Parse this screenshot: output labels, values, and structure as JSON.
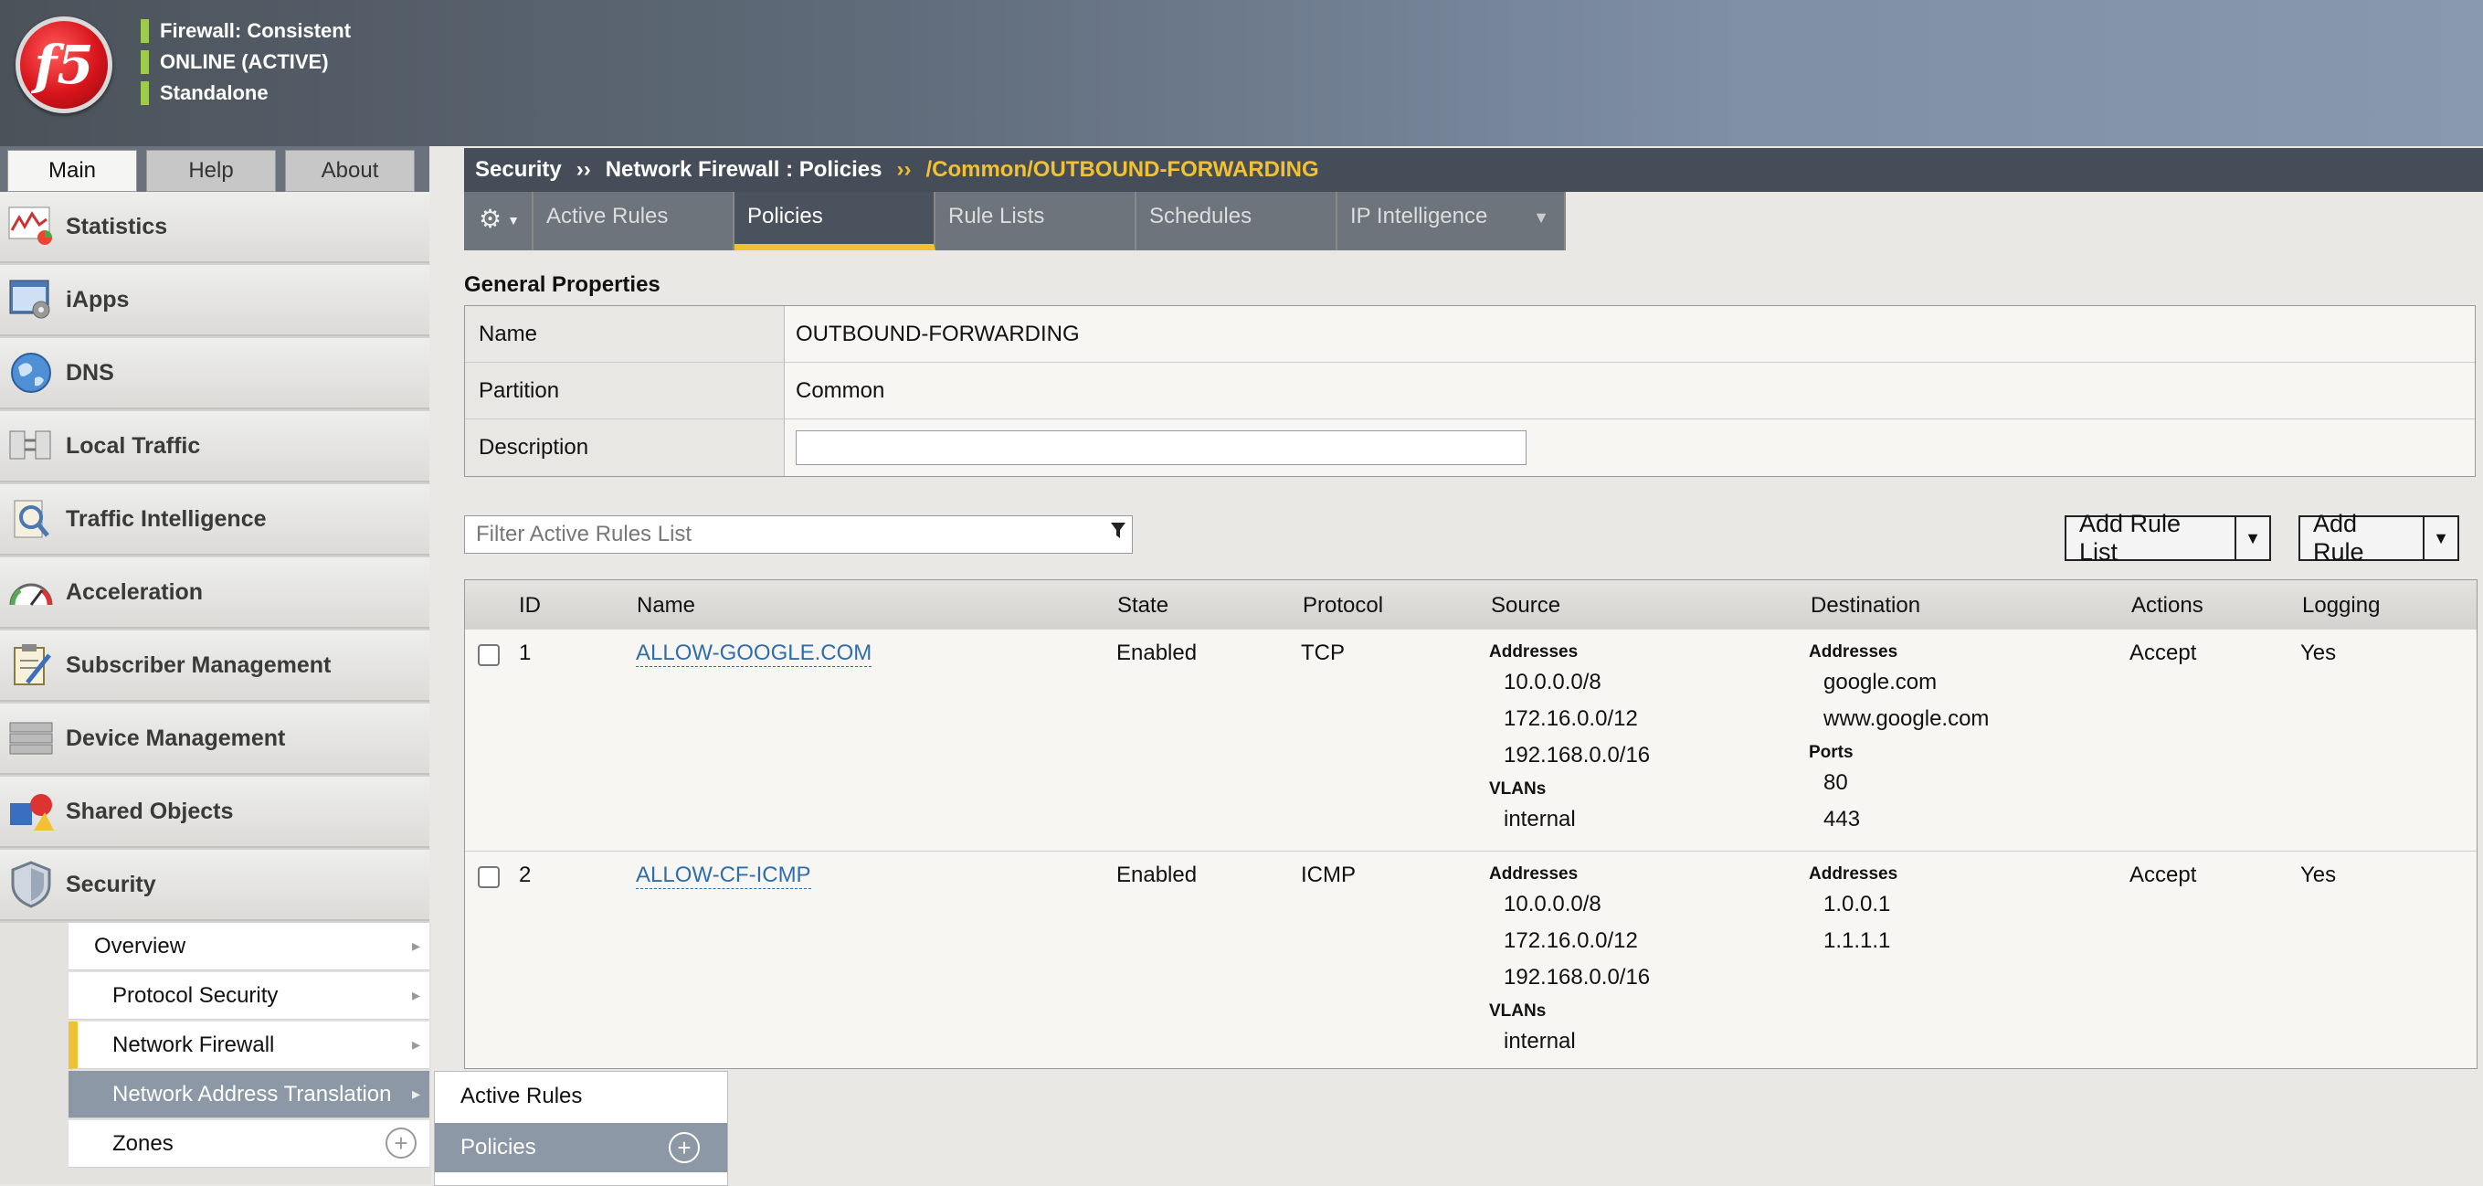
{
  "header": {
    "logo_text": "f5",
    "status": [
      "Firewall: Consistent",
      "ONLINE (ACTIVE)",
      "Standalone"
    ],
    "status_color": "#9ccb4d"
  },
  "main_tabs": [
    "Main",
    "Help",
    "About"
  ],
  "sidebar": {
    "items": [
      {
        "label": "Statistics",
        "icon": "statistics-icon"
      },
      {
        "label": "iApps",
        "icon": "iapps-icon"
      },
      {
        "label": "DNS",
        "icon": "globe-icon"
      },
      {
        "label": "Local Traffic",
        "icon": "local-traffic-icon"
      },
      {
        "label": "Traffic Intelligence",
        "icon": "traffic-intelligence-icon"
      },
      {
        "label": "Acceleration",
        "icon": "speedometer-icon"
      },
      {
        "label": "Subscriber Management",
        "icon": "clipboard-icon"
      },
      {
        "label": "Device Management",
        "icon": "server-icon"
      },
      {
        "label": "Shared Objects",
        "icon": "shapes-icon"
      },
      {
        "label": "Security",
        "icon": "shield-icon"
      }
    ],
    "submenu": [
      "Overview",
      "Protocol Security",
      "Network Firewall",
      "Network Address Translation",
      "Zones"
    ],
    "flyout": [
      "Active Rules",
      "Policies"
    ]
  },
  "breadcrumb": {
    "items": [
      "Security",
      "Network Firewall : Policies"
    ],
    "current": "/Common/OUTBOUND-FORWARDING",
    "separator": "››"
  },
  "subtabs": [
    "Active Rules",
    "Policies",
    "Rule Lists",
    "Schedules",
    "IP Intelligence"
  ],
  "general": {
    "title": "General Properties",
    "rows": [
      {
        "label": "Name",
        "value": "OUTBOUND-FORWARDING"
      },
      {
        "label": "Partition",
        "value": "Common"
      },
      {
        "label": "Description",
        "value": ""
      }
    ]
  },
  "filter_placeholder": "Filter Active Rules List",
  "buttons": {
    "add_rule_list": "Add Rule List",
    "add_rule": "Add Rule"
  },
  "rules": {
    "columns": [
      "ID",
      "Name",
      "State",
      "Protocol",
      "Source",
      "Destination",
      "Actions",
      "Logging"
    ],
    "sub_labels": {
      "addresses": "Addresses",
      "vlans": "VLANs",
      "ports": "Ports"
    },
    "rows": [
      {
        "id": "1",
        "name": "ALLOW-GOOGLE.COM",
        "state": "Enabled",
        "protocol": "TCP",
        "source": {
          "addresses": [
            "10.0.0.0/8",
            "172.16.0.0/12",
            "192.168.0.0/16"
          ],
          "vlans": [
            "internal"
          ]
        },
        "destination": {
          "addresses": [
            "google.com",
            "www.google.com"
          ],
          "ports": [
            "80",
            "443"
          ]
        },
        "action": "Accept",
        "logging": "Yes"
      },
      {
        "id": "2",
        "name": "ALLOW-CF-ICMP",
        "state": "Enabled",
        "protocol": "ICMP",
        "source": {
          "addresses": [
            "10.0.0.0/8",
            "172.16.0.0/12",
            "192.168.0.0/16"
          ],
          "vlans": [
            "internal"
          ]
        },
        "destination": {
          "addresses": [
            "1.0.0.1",
            "1.1.1.1"
          ]
        },
        "action": "Accept",
        "logging": "Yes"
      }
    ]
  },
  "colors": {
    "accent": "#f2c132",
    "link": "#2f6ea8",
    "breadcrumb_bg": "#454e58"
  }
}
